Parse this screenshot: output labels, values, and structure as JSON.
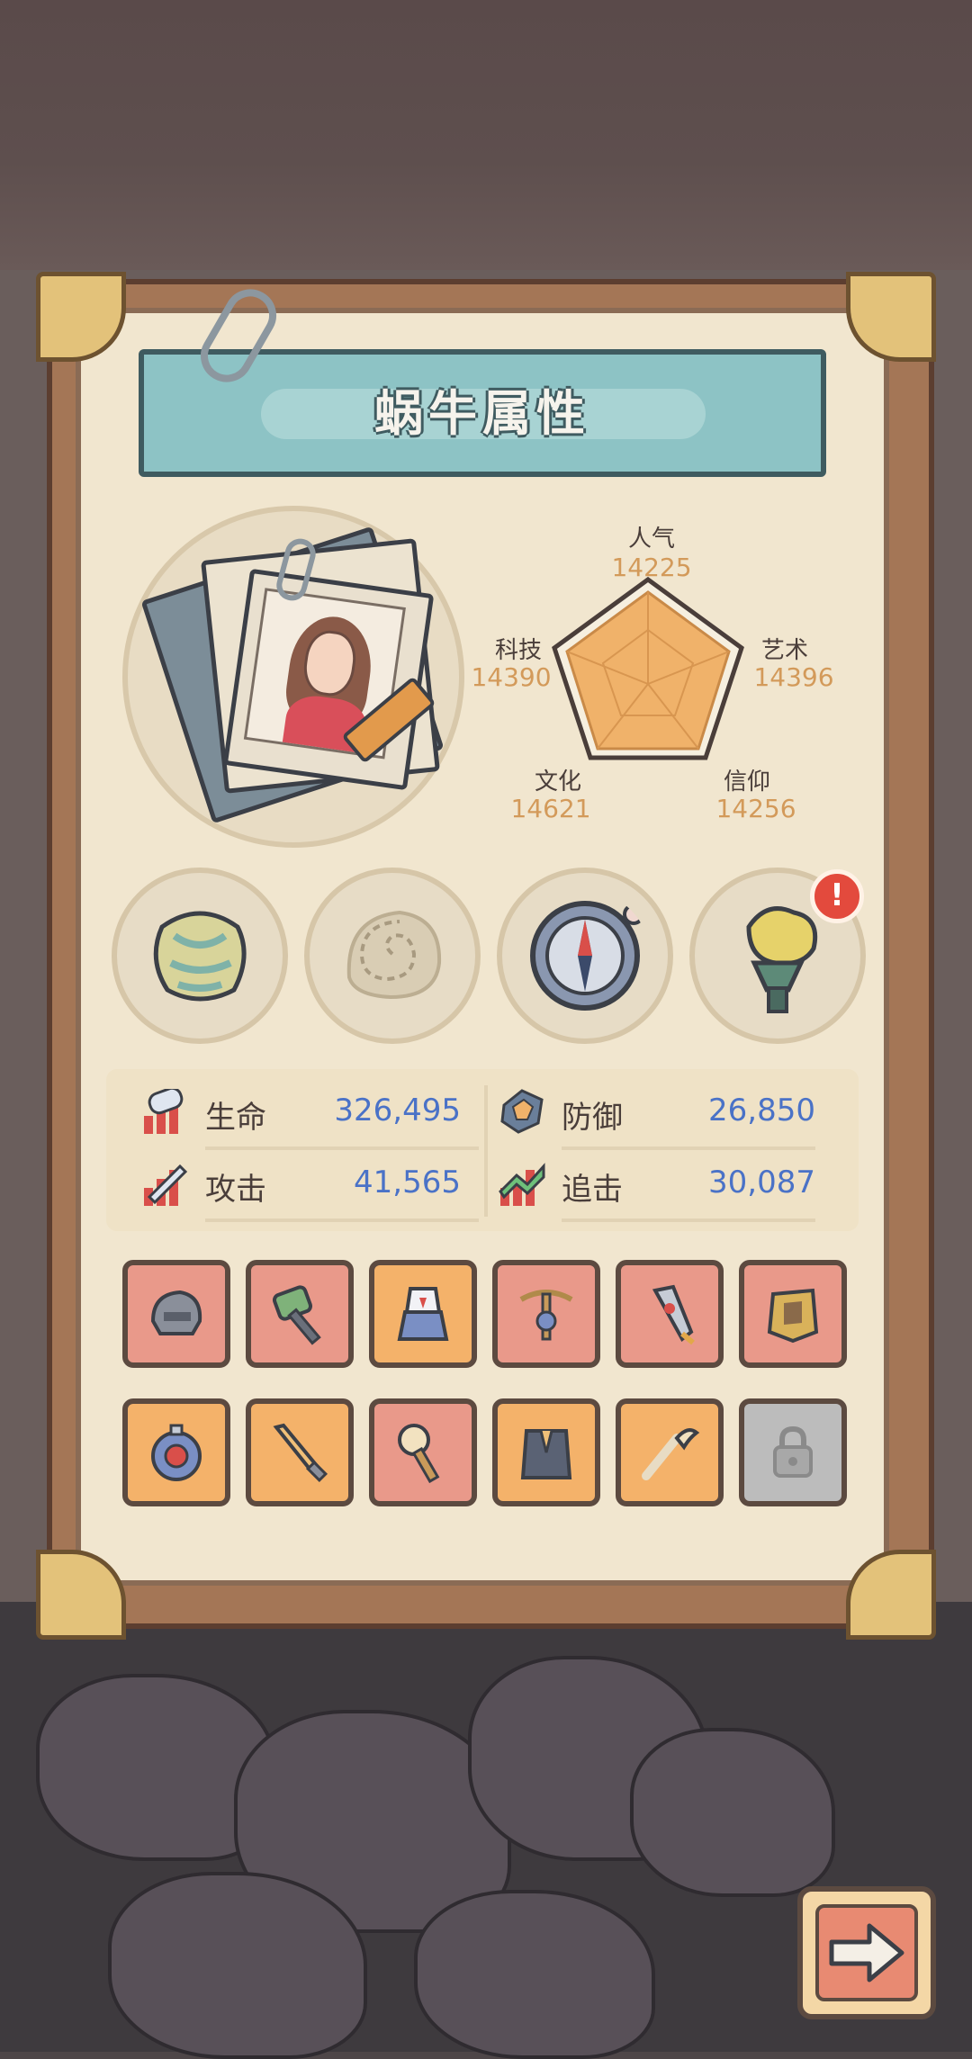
{
  "title": "蜗牛属性",
  "radar": {
    "axes": [
      {
        "label": "人气",
        "value": "14225"
      },
      {
        "label": "艺术",
        "value": "14396"
      },
      {
        "label": "信仰",
        "value": "14256"
      },
      {
        "label": "文化",
        "value": "14621"
      },
      {
        "label": "科技",
        "value": "14390"
      }
    ]
  },
  "relics": [
    {
      "icon": "bone-relic-icon"
    },
    {
      "icon": "snail-shell-relic-icon"
    },
    {
      "icon": "compass-relic-icon"
    },
    {
      "icon": "torch-relic-icon",
      "alert": "!"
    }
  ],
  "stats": [
    {
      "icon": "health-icon",
      "label": "生命",
      "value": "326,495"
    },
    {
      "icon": "defense-icon",
      "label": "防御",
      "value": "26,850"
    },
    {
      "icon": "attack-icon",
      "label": "攻击",
      "value": "41,565"
    },
    {
      "icon": "pursuit-icon",
      "label": "追击",
      "value": "30,087"
    }
  ],
  "equipment": [
    {
      "icon": "helmet-icon",
      "rarity": "red"
    },
    {
      "icon": "hammer-icon",
      "rarity": "red"
    },
    {
      "icon": "sailor-outfit-icon",
      "rarity": "orange"
    },
    {
      "icon": "crossbow-icon",
      "rarity": "red"
    },
    {
      "icon": "rocket-icon",
      "rarity": "red"
    },
    {
      "icon": "armor-icon",
      "rarity": "red"
    },
    {
      "icon": "diving-helmet-icon",
      "rarity": "orange"
    },
    {
      "icon": "sword-icon",
      "rarity": "orange"
    },
    {
      "icon": "skull-scepter-icon",
      "rarity": "red"
    },
    {
      "icon": "suit-jacket-icon",
      "rarity": "orange"
    },
    {
      "icon": "horn-pipe-icon",
      "rarity": "orange"
    },
    {
      "icon": "lock-icon",
      "rarity": "locked"
    }
  ],
  "colors": {
    "accent_value": "#4a72c7",
    "radar_value": "#d39a5a",
    "radar_fill": "#f0b26a"
  }
}
